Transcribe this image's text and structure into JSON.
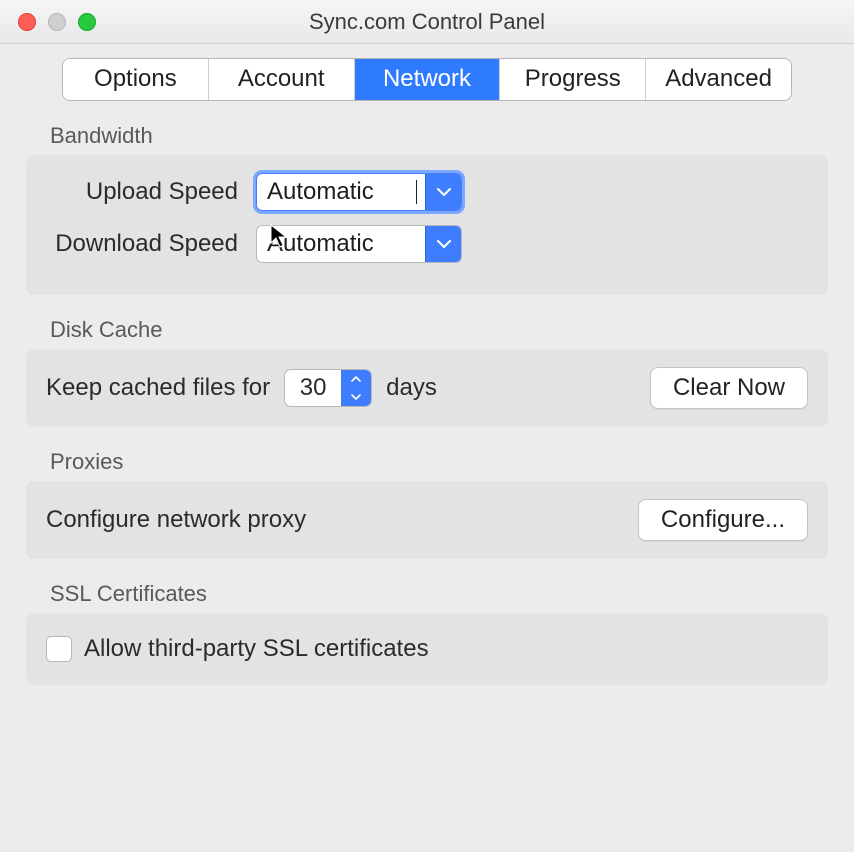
{
  "window": {
    "title": "Sync.com Control Panel"
  },
  "tabs": {
    "options": "Options",
    "account": "Account",
    "network": "Network",
    "progress": "Progress",
    "advanced": "Advanced",
    "active": "network"
  },
  "bandwidth": {
    "section_label": "Bandwidth",
    "upload_label": "Upload Speed",
    "upload_value": "Automatic",
    "download_label": "Download Speed",
    "download_value": "Automatic"
  },
  "disk_cache": {
    "section_label": "Disk Cache",
    "prefix": "Keep cached files for",
    "value": "30",
    "suffix": "days",
    "clear_button": "Clear Now"
  },
  "proxies": {
    "section_label": "Proxies",
    "label": "Configure network proxy",
    "button": "Configure..."
  },
  "ssl": {
    "section_label": "SSL Certificates",
    "checkbox_label": "Allow third-party SSL certificates",
    "checked": false
  }
}
